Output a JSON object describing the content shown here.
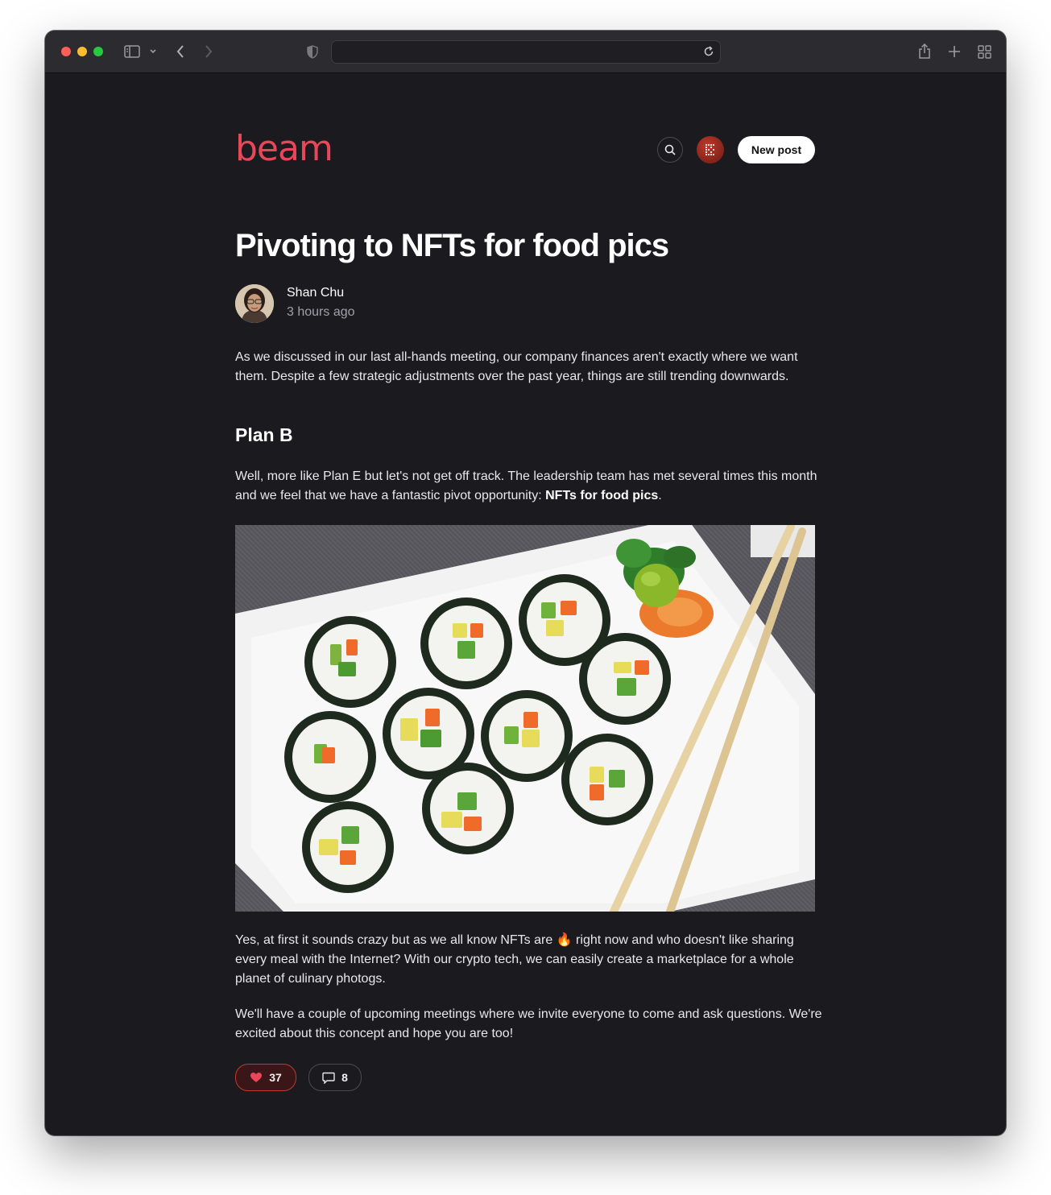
{
  "app": {
    "logo_text": "beam",
    "new_post_label": "New post",
    "accent_color": "#e8475a"
  },
  "browser": {
    "url": "",
    "icons": [
      "sidebar-icon",
      "chevron-down-icon",
      "back-icon",
      "forward-icon",
      "shield-icon",
      "reload-icon",
      "share-icon",
      "new-tab-icon",
      "tab-overview-icon"
    ]
  },
  "post": {
    "title": "Pivoting to NFTs for food pics",
    "author": "Shan Chu",
    "time": "3 hours ago",
    "intro": "As we discussed in our last all-hands meeting, our company finances aren't exactly where we want them. Despite a few strategic adjustments over the past year, things are still trending downwards.",
    "section_heading": "Plan B",
    "plan_text_before": "Well, more like Plan E but let's not get off track. The leadership team has met several times this month and we feel that we have a fantastic pivot opportunity: ",
    "plan_bold": "NFTs for food pics",
    "plan_text_after": ".",
    "after_image_before": "Yes, at first it sounds crazy but as we all know NFTs are ",
    "fire_emoji": "🔥",
    "after_image_after": " right now and who doesn't like sharing every meal with the Internet? With our crypto tech, we can easily create a marketplace for a whole planet of culinary photogs.",
    "closing": "We'll have a couple of upcoming meetings where we invite everyone to come and ask questions. We're excited about this concept and hope you are too!",
    "likes": "37",
    "comments": "8",
    "like_color": "#e8475a"
  }
}
